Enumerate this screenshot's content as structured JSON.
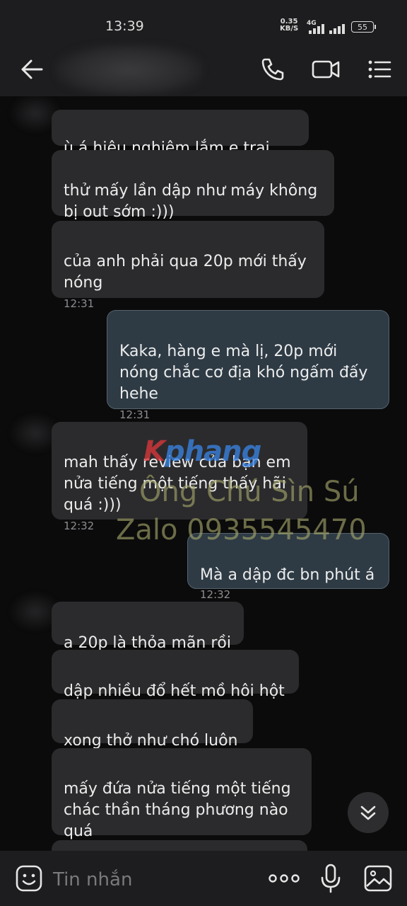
{
  "status_bar": {
    "time": "13:39",
    "speed_value": "0.35",
    "speed_unit": "KB/S",
    "network": "4G",
    "battery": "55"
  },
  "header": {
    "back_icon": "arrow-left-icon",
    "call_icon": "phone-icon",
    "video_icon": "video-camera-icon",
    "menu_icon": "list-menu-icon"
  },
  "messages": [
    {
      "direction": "in",
      "text": "ù á hiệu nghiệm lắm e trai :)))"
    },
    {
      "direction": "in",
      "text": "thử mấy lần dập như máy không\nbị out sớm :)))"
    },
    {
      "direction": "in",
      "text": "của anh phải qua 20p mới thấy\nnóng",
      "time": "12:31"
    },
    {
      "direction": "out",
      "text": "Kaka, hàng e mà lị, 20p mới\nnóng chắc cơ địa khó ngấm đấy\nhehe",
      "time": "12:31"
    },
    {
      "direction": "in",
      "text": "mah thấy review của bạn em\nnửa tiếng một tiếng thấy hãi\nquá :)))",
      "time": "12:32"
    },
    {
      "direction": "out",
      "text": "Mà a dập đc bn phút á",
      "time": "12:32"
    },
    {
      "direction": "in",
      "text": "a 20p là thỏa mãn rồi"
    },
    {
      "direction": "in",
      "text": "dập nhiều đổ hết mồ hôi hột"
    },
    {
      "direction": "in",
      "text": "xong thở như chó luôn"
    },
    {
      "direction": "in",
      "text": "mấy đứa nửa tiếng một tiếng\nchác thần tháng phương nào\nquá"
    }
  ],
  "watermark": {
    "logo_part1": "K",
    "logo_part2": "phang",
    "line1": "Ông Chú Sìn Sú",
    "line2": "Zalo 0935545470"
  },
  "scroll_icon": "chevron-double-down-icon",
  "input_bar": {
    "placeholder": "Tin nhắn",
    "emoji_icon": "emoji-icon",
    "more_icon": "more-dots-icon",
    "mic_icon": "microphone-icon",
    "image_icon": "image-icon"
  },
  "colors": {
    "background": "#0b0b0c",
    "incoming_bubble": "#2b2b2d",
    "outgoing_bubble": "#2e3b45",
    "bar": "#1d1d1f"
  }
}
